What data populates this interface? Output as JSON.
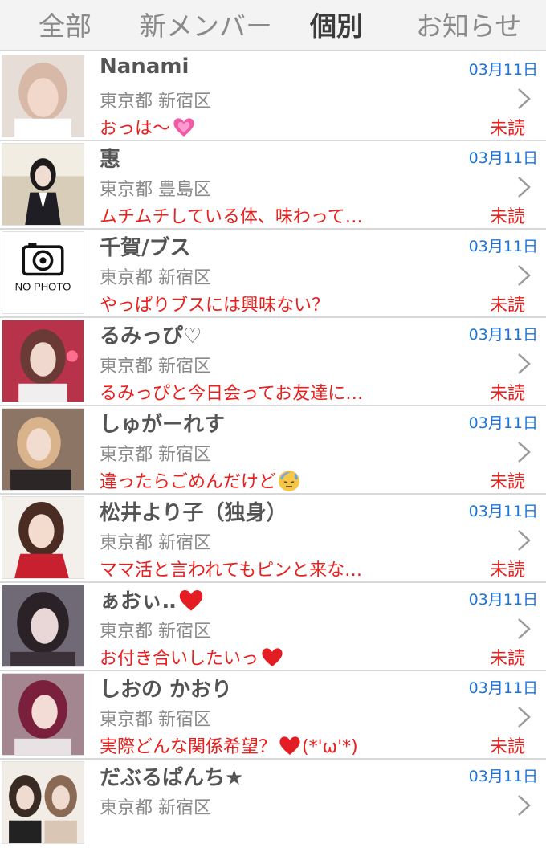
{
  "tabs": [
    {
      "label": "全部",
      "active": false
    },
    {
      "label": "新メンバー",
      "active": false
    },
    {
      "label": "個別",
      "active": true
    },
    {
      "label": "お知らせ",
      "active": false
    }
  ],
  "colors": {
    "date": "#1e73d6",
    "unread": "#e8211f",
    "name": "#555555",
    "location": "#8a8a8a"
  },
  "messages": [
    {
      "name": "Nanami",
      "date": "03月11日",
      "location": "東京都 新宿区",
      "preview": "おっは〜",
      "emoji": "sparkling-heart",
      "status": "未読"
    },
    {
      "name": "惠",
      "date": "03月11日",
      "location": "東京都 豊島区",
      "preview": "ムチムチしている体、味わって…",
      "status": "未読"
    },
    {
      "name": "千賀/ブス",
      "date": "03月11日",
      "location": "東京都 新宿区",
      "preview": "やっぱりブスには興味ない？",
      "status": "未読",
      "no_photo_label": "NO PHOTO"
    },
    {
      "name": "るみっぴ♡",
      "date": "03月11日",
      "location": "東京都 新宿区",
      "preview": "るみっぴと今日会ってお友達に…",
      "status": "未読"
    },
    {
      "name": "しゅがーれす",
      "date": "03月11日",
      "location": "東京都 新宿区",
      "preview": "違ったらごめんだけど",
      "emoji": "sweat-face",
      "status": "未読"
    },
    {
      "name": "松井より子（独身）",
      "date": "03月11日",
      "location": "東京都 新宿区",
      "preview": "ママ活と言われてもピンと来な…",
      "status": "未読"
    },
    {
      "name": "ぁおぃ‥",
      "name_emoji": "red-heart",
      "date": "03月11日",
      "location": "東京都 新宿区",
      "preview": "お付き合いしたいっ",
      "emoji": "red-heart",
      "status": "未読"
    },
    {
      "name": "しおの かおり",
      "date": "03月11日",
      "location": "東京都 新宿区",
      "preview": "実際どんな関係希望？",
      "emoji": "red-heart",
      "preview_suffix": "(*'ω'*)",
      "status": "未読"
    },
    {
      "name": "だぶるぱんち★",
      "date": "03月11日",
      "location": "東京都 新宿区",
      "preview": "",
      "status": ""
    }
  ]
}
